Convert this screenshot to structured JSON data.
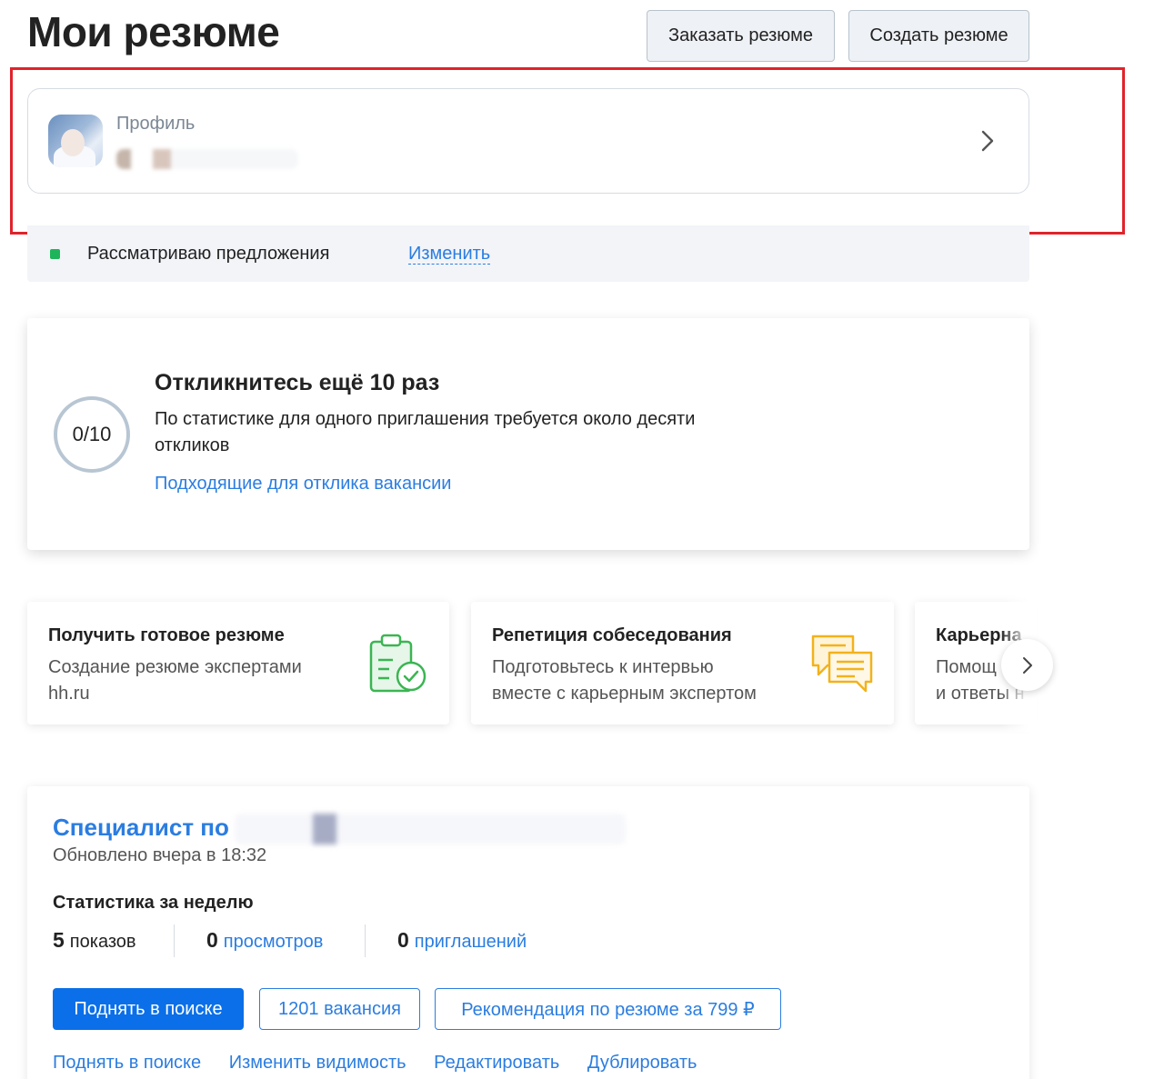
{
  "header": {
    "title": "Мои резюме",
    "order_button": "Заказать резюме",
    "create_button": "Создать резюме"
  },
  "profile": {
    "label": "Профиль"
  },
  "status": {
    "text": "Рассматриваю предложения",
    "change_link": "Изменить",
    "color": "#1eb55a"
  },
  "responses": {
    "progress": "0/10",
    "progress_value": 0,
    "title": "Откликнитесь ещё 10 раз",
    "description": "По статистике для одного приглашения требуется около десяти откликов",
    "link": "Подходящие для отклика вакансии"
  },
  "services": [
    {
      "title": "Получить готовое резюме",
      "desc_line1": "Создание резюме экспертами",
      "desc_line2": "hh.ru",
      "icon": "clipboard-check-icon"
    },
    {
      "title": "Репетиция собеседования",
      "desc_line1": "Подготовьтесь к интервью",
      "desc_line2": "вместе с карьерным экспертом",
      "icon": "chat-bubbles-icon"
    },
    {
      "title": "Карьерна",
      "desc_line1": "Помощ",
      "desc_line2": "и ответы н"
    }
  ],
  "resume": {
    "title": "Специалист по",
    "updated": "Обновлено вчера в 18:32",
    "stats_heading": "Статистика за неделю",
    "stats": [
      {
        "num": "5",
        "label": "показов"
      },
      {
        "num": "0",
        "label": "просмотров"
      },
      {
        "num": "0",
        "label": "приглашений"
      }
    ],
    "raise_button": "Поднять в поиске",
    "vacancies_button": "1201 вакансия",
    "recommend_button": "Рекомендация по резюме за 799 ₽",
    "links": [
      "Поднять в поиске",
      "Изменить видимость",
      "Редактировать",
      "Дублировать"
    ]
  },
  "colors": {
    "accent": "#2b7de0",
    "primary_button": "#0a6fe8",
    "highlight": "#e0232b"
  }
}
